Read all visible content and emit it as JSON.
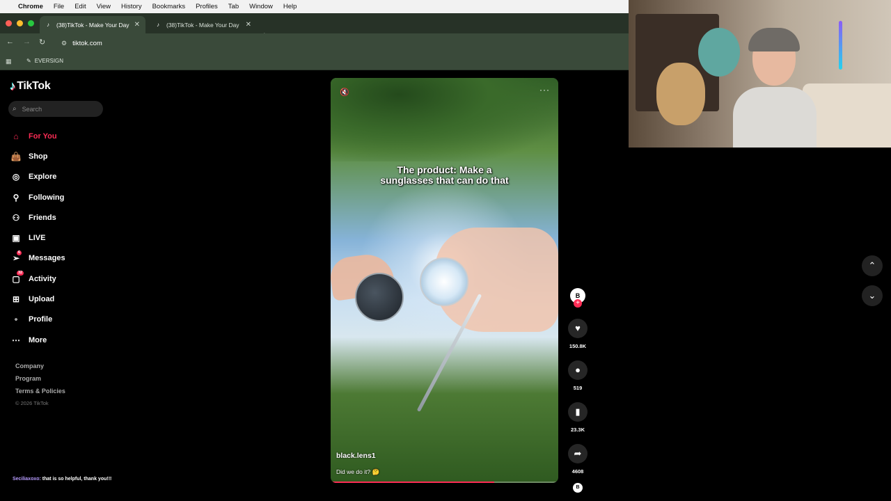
{
  "menubar": {
    "app": "Chrome",
    "items": [
      "File",
      "Edit",
      "View",
      "History",
      "Bookmarks",
      "Profiles",
      "Tab",
      "Window",
      "Help"
    ]
  },
  "tabs": [
    {
      "label": "(38)TikTok - Make Your Day",
      "active": true
    },
    {
      "label": "(38)TikTok - Make Your Day",
      "active": false
    }
  ],
  "address": {
    "url": "tiktok.com"
  },
  "bookmarks": [
    {
      "label": "EVERSIGN"
    }
  ],
  "tiktok": {
    "brand": "TikTok",
    "search_placeholder": "Search",
    "nav": [
      {
        "label": "For You",
        "icon": "home-icon",
        "active": true
      },
      {
        "label": "Shop",
        "icon": "shopping-bag-icon"
      },
      {
        "label": "Explore",
        "icon": "compass-icon"
      },
      {
        "label": "Following",
        "icon": "following-icon"
      },
      {
        "label": "Friends",
        "icon": "friends-icon"
      },
      {
        "label": "LIVE",
        "icon": "live-icon"
      },
      {
        "label": "Messages",
        "icon": "messages-icon",
        "badge": "6"
      },
      {
        "label": "Activity",
        "icon": "activity-icon",
        "badge": "32"
      },
      {
        "label": "Upload",
        "icon": "upload-icon"
      },
      {
        "label": "Profile",
        "icon": "profile-icon"
      },
      {
        "label": "More",
        "icon": "more-icon"
      }
    ],
    "footer": {
      "company": "Company",
      "program": "Program",
      "terms": "Terms & Policies",
      "copyright": "© 2026 TikTok"
    },
    "video": {
      "caption_line1": "The product: Make a",
      "caption_line2": "sunglasses that can do that",
      "author": "black.lens1",
      "description": "Did we do it? 🤔",
      "progress": 0.72
    },
    "actions": {
      "likes": "150.8K",
      "comments": "519",
      "saves": "23.3K",
      "shares": "4608"
    }
  },
  "chat": {
    "user": "Seciliaxoxo:",
    "message": " that is so helpful, thank you!!!"
  },
  "colors": {
    "accent": "#fe2c55",
    "chrome_frame": "#3a4a3a"
  }
}
